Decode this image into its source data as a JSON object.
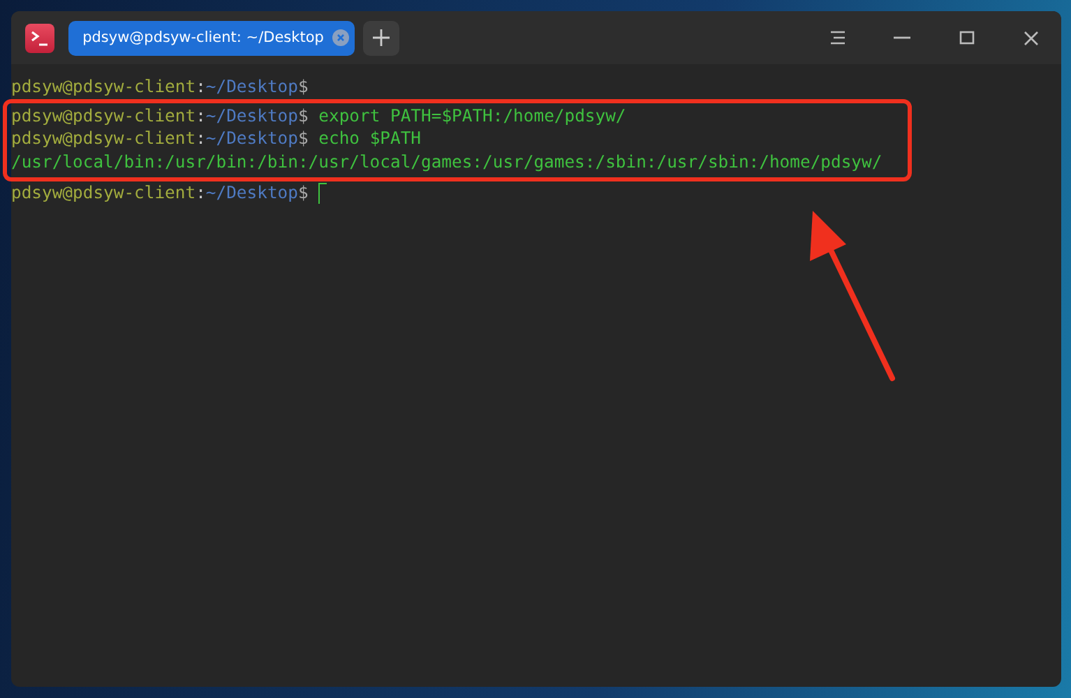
{
  "window": {
    "tab_title": "pdsyw@pdsyw-client: ~/Desktop"
  },
  "terminal": {
    "lines": [
      {
        "kind": "prompt",
        "user": "pdsyw@pdsyw-client",
        "separator": ":",
        "path": "~/Desktop",
        "symbol": "$",
        "highlighted": false,
        "cursor": false
      },
      {
        "kind": "prompt",
        "user": "pdsyw@pdsyw-client",
        "separator": ":",
        "path": "~/Desktop",
        "symbol": "$",
        "command": "export PATH=$PATH:/home/pdsyw/",
        "highlighted": true,
        "cursor": false
      },
      {
        "kind": "prompt",
        "user": "pdsyw@pdsyw-client",
        "separator": ":",
        "path": "~/Desktop",
        "symbol": "$",
        "command": "echo $PATH",
        "highlighted": true,
        "cursor": false
      },
      {
        "kind": "output",
        "text": "/usr/local/bin:/usr/bin:/bin:/usr/local/games:/usr/games:/sbin:/usr/sbin:/home/pdsyw/",
        "highlighted": true
      },
      {
        "kind": "prompt",
        "user": "pdsyw@pdsyw-client",
        "separator": ":",
        "path": "~/Desktop",
        "symbol": "$",
        "highlighted": false,
        "cursor": true
      }
    ]
  }
}
